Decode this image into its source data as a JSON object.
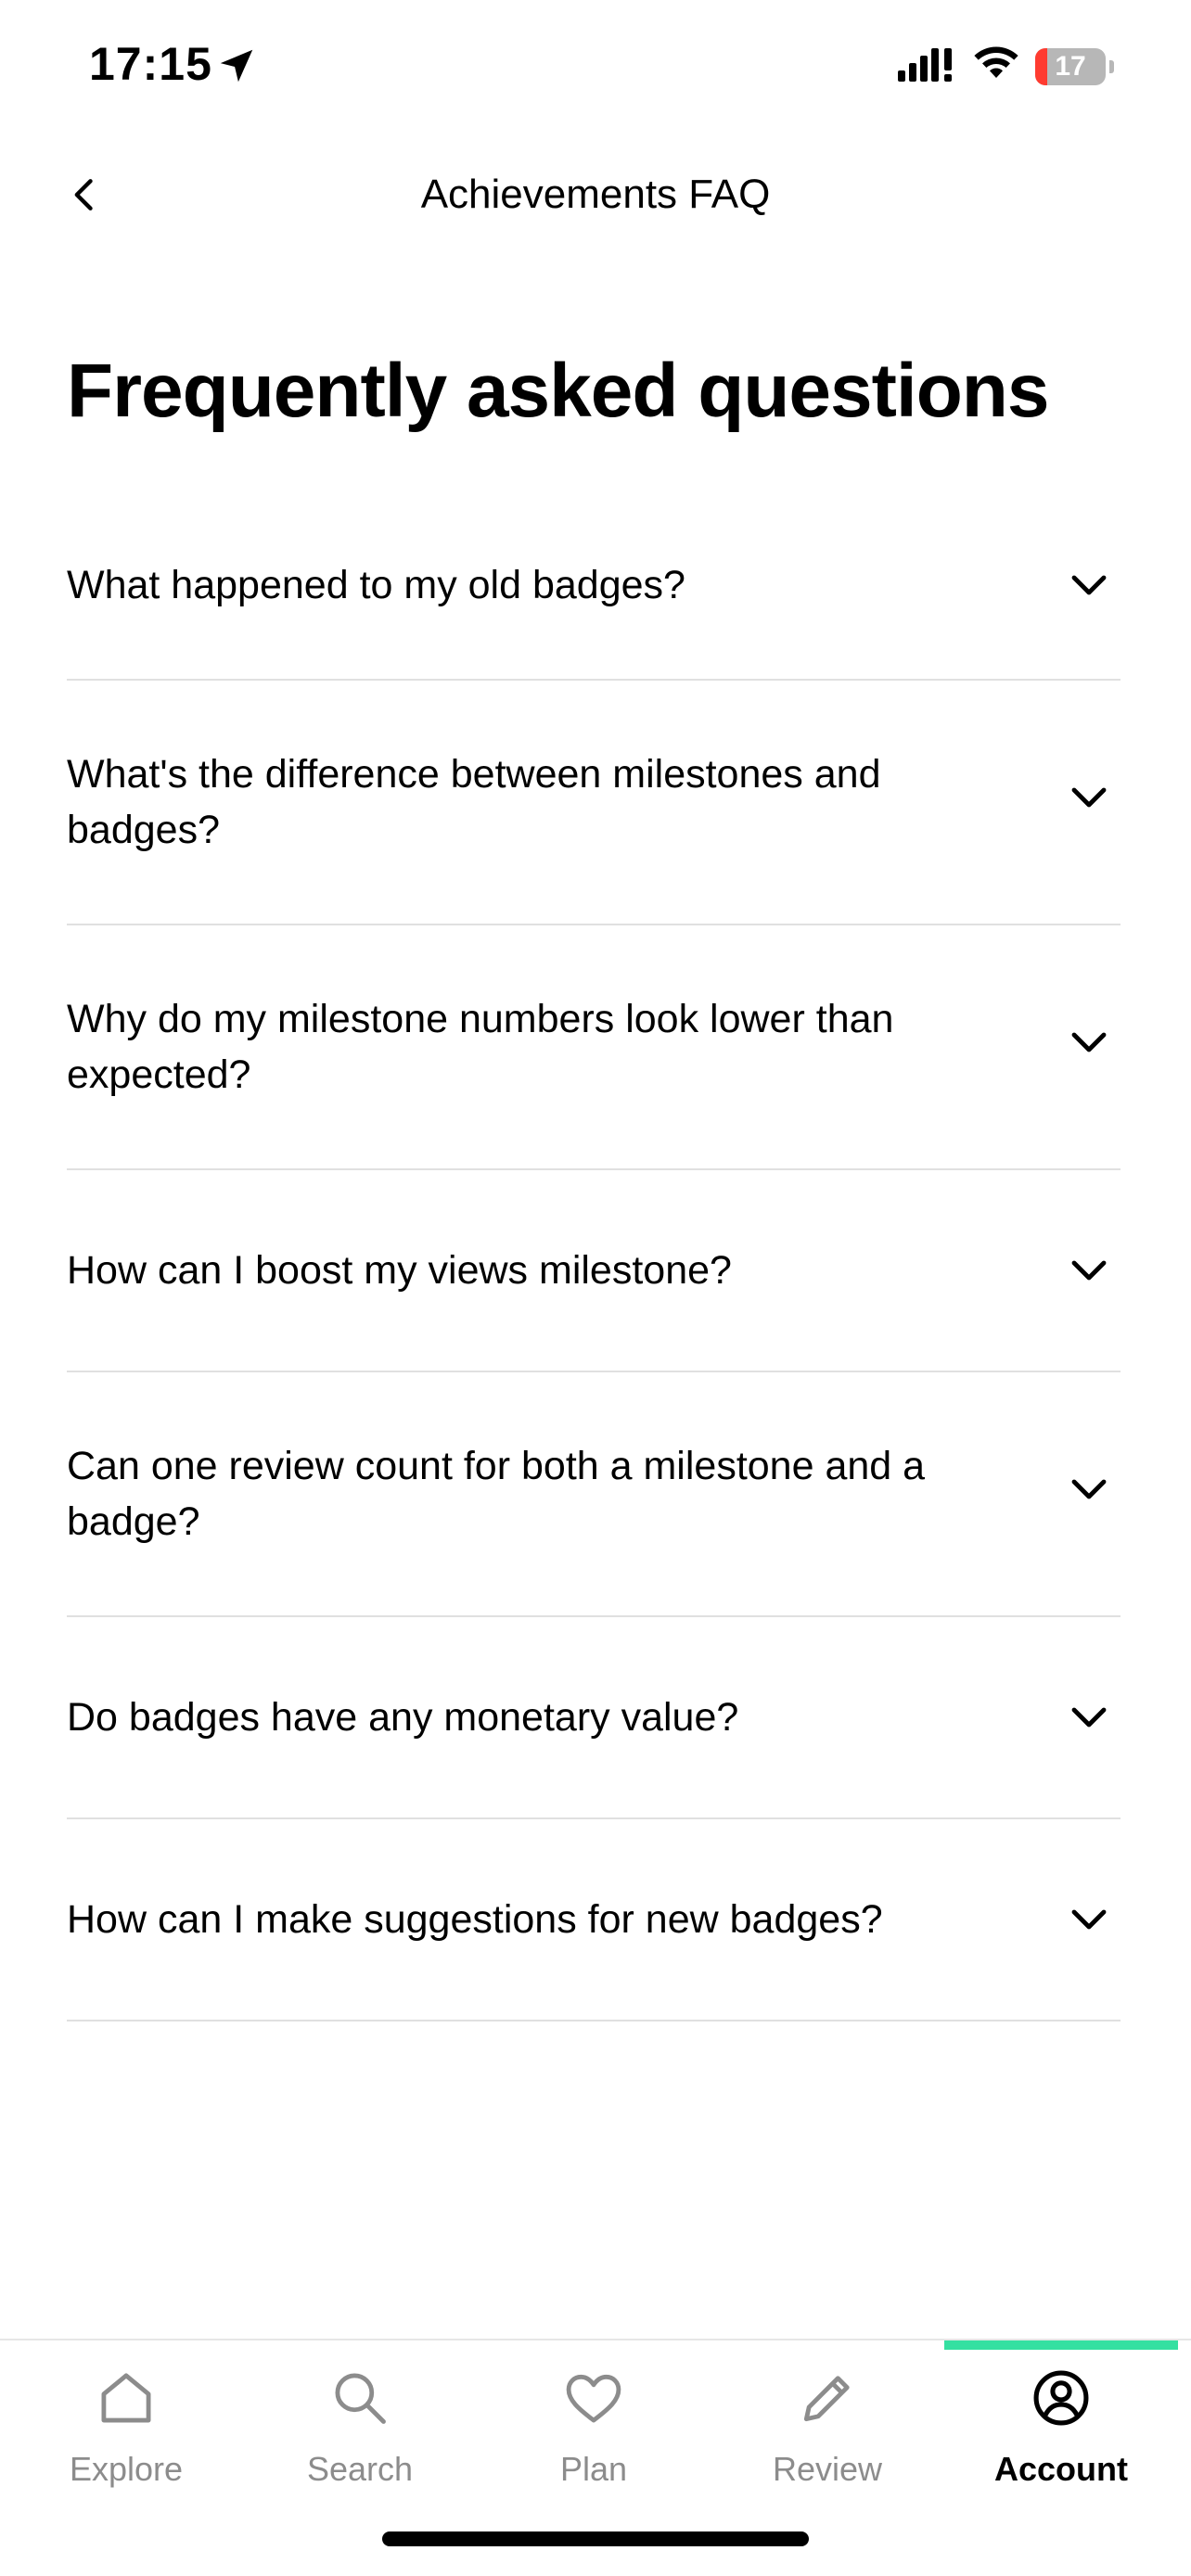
{
  "status_bar": {
    "time": "17:15",
    "battery_level": "17",
    "battery_percent": 17
  },
  "header": {
    "title": "Achievements FAQ",
    "back_icon": "chevron-left-icon"
  },
  "page": {
    "heading": "Frequently asked questions"
  },
  "faq": {
    "items": [
      {
        "question": "What happened to my old badges?"
      },
      {
        "question": "What's the difference between milestones and badges?"
      },
      {
        "question": "Why do my milestone numbers look lower than expected?"
      },
      {
        "question": "How can I boost my views milestone?"
      },
      {
        "question": "Can one review count for both a milestone and a badge?"
      },
      {
        "question": "Do badges have any monetary value?"
      },
      {
        "question": "How can I make suggestions for new badges?"
      }
    ],
    "expand_icon": "chevron-down-icon"
  },
  "tab_bar": {
    "tabs": [
      {
        "label": "Explore",
        "icon": "home-icon"
      },
      {
        "label": "Search",
        "icon": "search-icon"
      },
      {
        "label": "Plan",
        "icon": "heart-icon"
      },
      {
        "label": "Review",
        "icon": "pencil-icon"
      },
      {
        "label": "Account",
        "icon": "account-icon"
      }
    ],
    "active": "Account",
    "accent_color": "#34e0a1"
  }
}
